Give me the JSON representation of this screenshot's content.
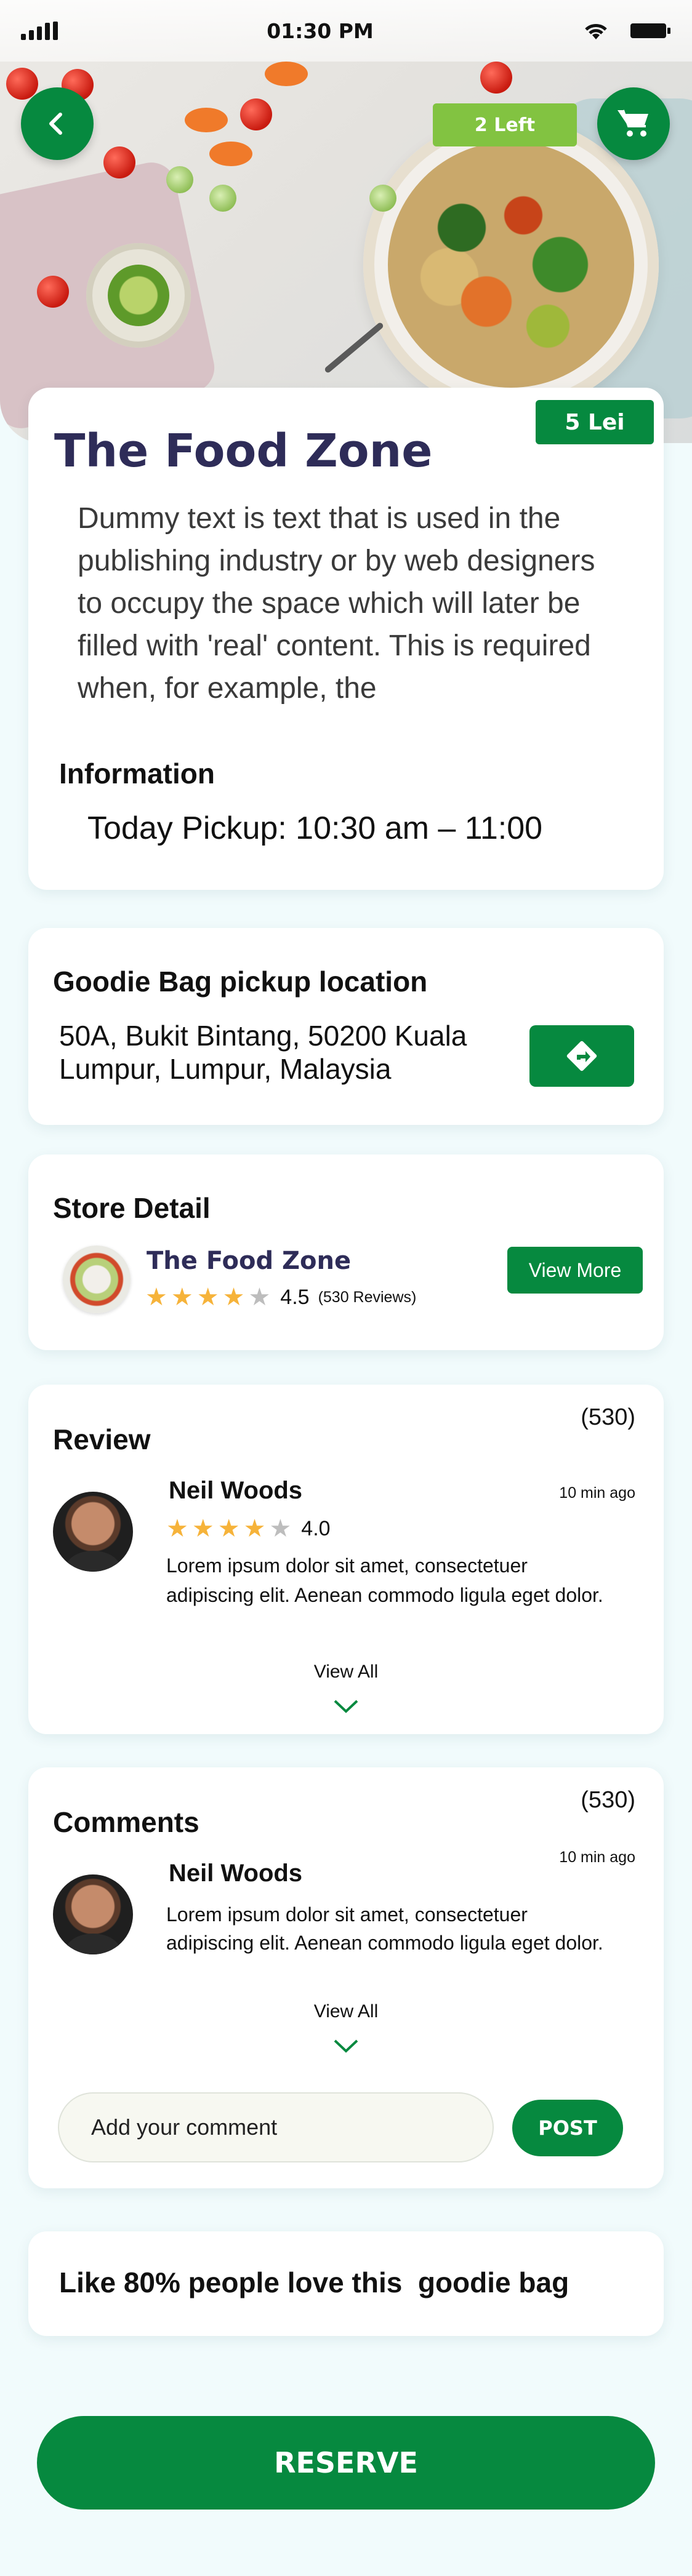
{
  "status_bar": {
    "time": "01:30 PM",
    "icons": [
      "signal-icon",
      "wifi-icon",
      "battery-icon"
    ]
  },
  "hero": {
    "left_badge": "2 Left",
    "icons": [
      "back-arrow-icon",
      "cart-icon"
    ]
  },
  "main": {
    "price": "5 Lei",
    "title": "The Food Zone",
    "description": "Dummy text is text that is used in the publishing industry or by web designers to occupy the space which will later be filled with 'real' content. This is required when, for example, the",
    "info_title": "Information",
    "pickup": "Today Pickup: 10:30 am – 11:00"
  },
  "location": {
    "title": "Goodie Bag pickup location",
    "address": "50A, Bukit Bintang, 50200 Kuala Lumpur, Lumpur, Malaysia",
    "direction_icon": "directions-icon"
  },
  "store_detail": {
    "title": "Store Detail",
    "name": "The Food Zone",
    "rating": "4.5",
    "rating_stars": 4,
    "reviews": "(530 Reviews)",
    "view_more": "View More"
  },
  "review": {
    "title": "Review",
    "count": "(530)",
    "item": {
      "name": "Neil Woods",
      "time": "10 min ago",
      "rating": "4.0",
      "rating_stars": 4,
      "text": "Lorem ipsum dolor sit amet, consectetuer adipiscing elit. Aenean commodo ligula eget dolor."
    },
    "view_all": "View All"
  },
  "comments": {
    "title": "Comments",
    "count": "(530)",
    "item": {
      "name": "Neil Woods",
      "time": "10 min ago",
      "text": "Lorem ipsum dolor sit amet, consectetuer adipiscing elit. Aenean commodo ligula eget dolor."
    },
    "view_all": "View All",
    "input_placeholder": "Add your comment",
    "post": "POST"
  },
  "like": {
    "text": "Like 80% people love this  goodie bag"
  },
  "reserve": "RESERVE",
  "colors": {
    "primary_green": "#06893f",
    "light_green": "#82c341",
    "title_navy": "#2e2c58",
    "star": "#f6b33a",
    "page_bg": "#f1fbfc"
  }
}
